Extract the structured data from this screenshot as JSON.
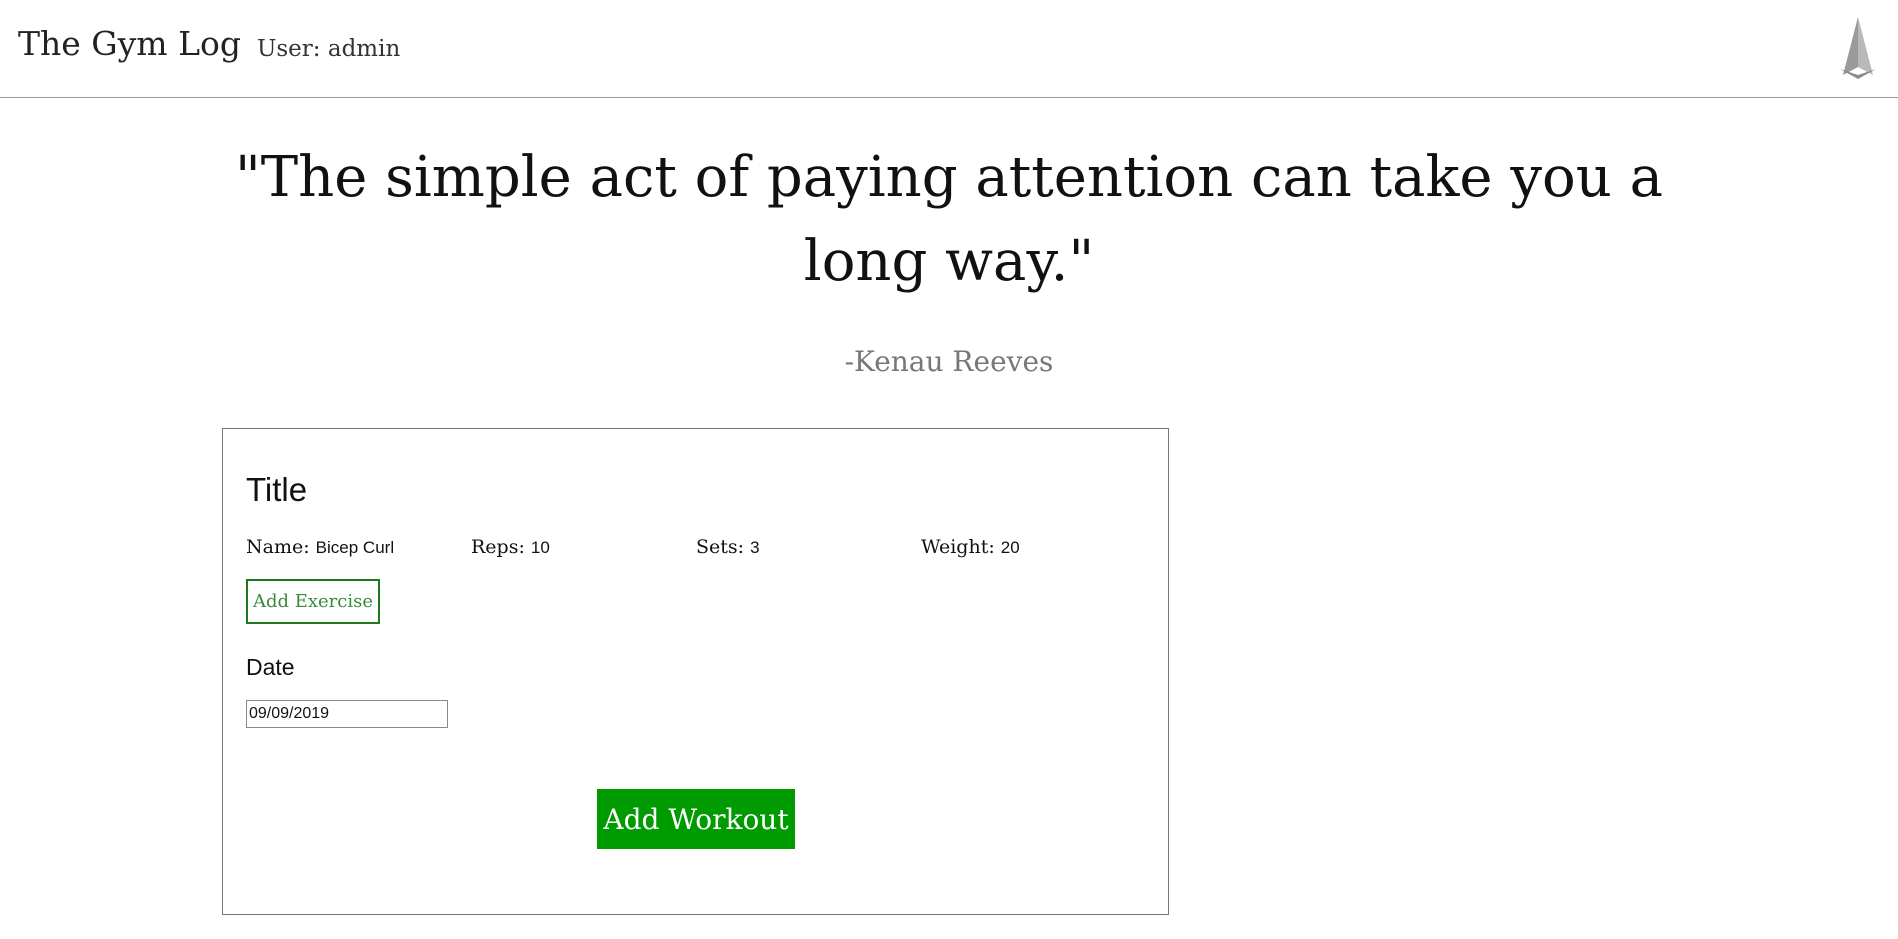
{
  "header": {
    "brand": "The Gym Log",
    "user_info": "User: admin",
    "logo_icon": "sailboat-logo-icon"
  },
  "quote": {
    "text": "\"The simple act of paying attention can take you a long way.\"",
    "author": "-Kenau Reeves"
  },
  "workout_form": {
    "title": "Title",
    "exercise": {
      "name_label": "Name:",
      "name_value": "Bicep Curl",
      "reps_label": "Reps:",
      "reps_value": "10",
      "sets_label": "Sets:",
      "sets_value": "3",
      "weight_label": "Weight:",
      "weight_value": "20"
    },
    "add_exercise_label": "Add Exercise",
    "date_label": "Date",
    "date_value": "09/09/2019",
    "add_workout_label": "Add Workout"
  },
  "colors": {
    "primary_green": "#009b00",
    "outline_green": "#1c7a1c",
    "author_gray": "#777777",
    "logo_gray": "#9a9a9a"
  }
}
